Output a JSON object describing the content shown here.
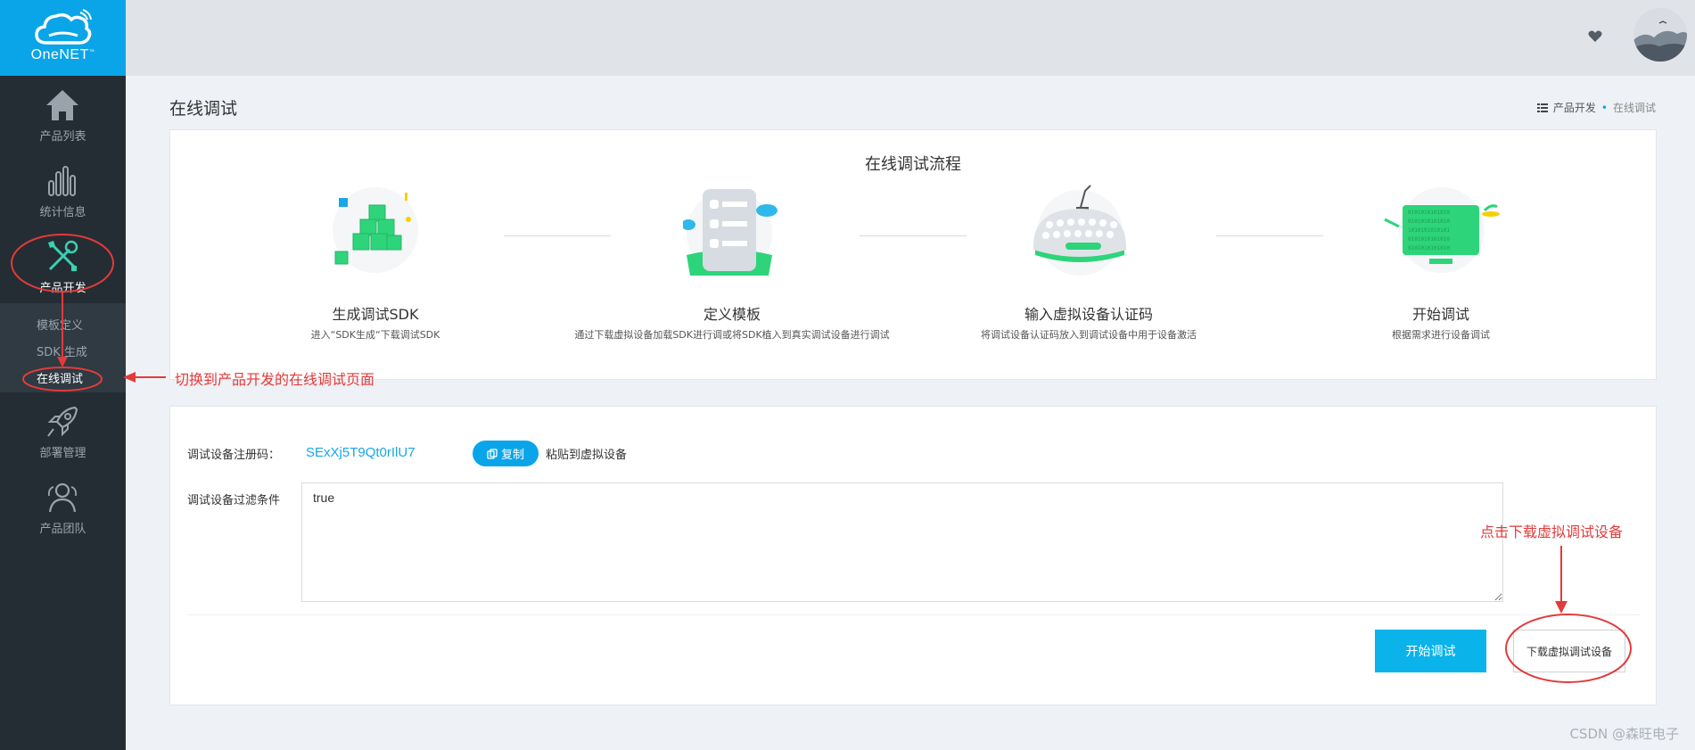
{
  "sidebar": {
    "brand": "OneNET",
    "brand_mark": "™",
    "items": [
      {
        "label": "产品列表"
      },
      {
        "label": "统计信息"
      },
      {
        "label": "产品开发"
      },
      {
        "label": "部署管理"
      },
      {
        "label": "产品团队"
      }
    ],
    "subitems": [
      {
        "label": "模板定义"
      },
      {
        "label": "SDK 生成"
      },
      {
        "label": "在线调试"
      }
    ]
  },
  "header": {
    "page_title": "在线调试"
  },
  "breadcrumb": {
    "parent": "产品开发",
    "current": "在线调试"
  },
  "flow": {
    "title": "在线调试流程",
    "steps": [
      {
        "title": "生成调试SDK",
        "desc": "进入“SDK生成“下载调试SDK"
      },
      {
        "title": "定义模板",
        "desc": "通过下载虚拟设备加载SDK进行调或将SDK植入到真实调试设备进行调试"
      },
      {
        "title": "输入虚拟设备认证码",
        "desc": "将调试设备认证码放入到调试设备中用于设备激活"
      },
      {
        "title": "开始调试",
        "desc": "根据需求进行设备调试"
      }
    ]
  },
  "form": {
    "code_label": "调试设备注册码：",
    "code_value": "SExXj5T9Qt0rIlU7",
    "copy_label": "复制",
    "paste_hint": "粘贴到虚拟设备",
    "filter_label": "调试设备过滤条件",
    "filter_value": "true",
    "start_button": "开始调试",
    "download_button": "下载虚拟调试设备"
  },
  "annotations": {
    "switch_note": "切换到产品开发的在线调试页面",
    "download_note": "点击下载虚拟调试设备"
  },
  "watermark": "CSDN @森旺电子",
  "colors": {
    "accent": "#0aa5e8",
    "sidebar": "#252d34",
    "annotation": "#e23b3b",
    "green": "#2ed47a"
  }
}
